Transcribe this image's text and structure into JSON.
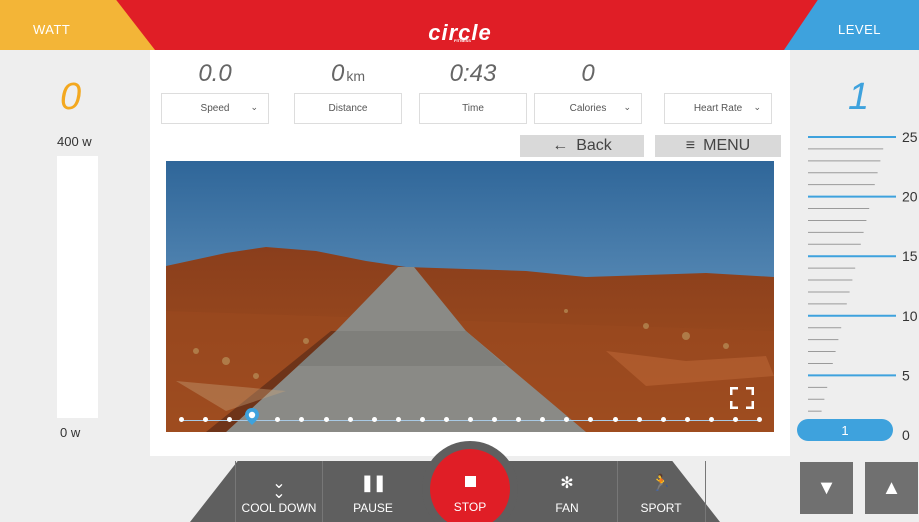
{
  "header": {
    "watt_tab": "WATT",
    "level_tab": "LEVEL",
    "brand": "circle",
    "brand_sub": "FITNESS"
  },
  "watt": {
    "value": "0",
    "max_label": "400 w",
    "min_label": "0 w"
  },
  "metrics": [
    {
      "value": "0.0",
      "unit": "",
      "label": "Speed",
      "dropdown": true
    },
    {
      "value": "0",
      "unit": "km",
      "label": "Distance",
      "dropdown": false
    },
    {
      "value": "0:43",
      "unit": "",
      "label": "Time",
      "dropdown": false
    },
    {
      "value": "0",
      "unit": "",
      "label": "Calories",
      "dropdown": true
    },
    {
      "value": "",
      "unit": "",
      "label": "Heart Rate",
      "dropdown": true
    }
  ],
  "nav": {
    "back_label": "Back",
    "menu_label": "MENU"
  },
  "video": {
    "progress_fraction": 0.14
  },
  "level": {
    "value": "1",
    "current_badge": "1",
    "ticks": [
      "25",
      "20",
      "15",
      "10",
      "5",
      "0"
    ]
  },
  "controls": {
    "cool_down": "COOL DOWN",
    "pause": "PAUSE",
    "stop": "STOP",
    "fan": "FAN",
    "sport": "SPORT"
  },
  "colors": {
    "brand_red": "#e01e26",
    "watt_yellow": "#f3b537",
    "level_blue": "#3ea2dd",
    "control_gray": "#5f5f5f"
  }
}
